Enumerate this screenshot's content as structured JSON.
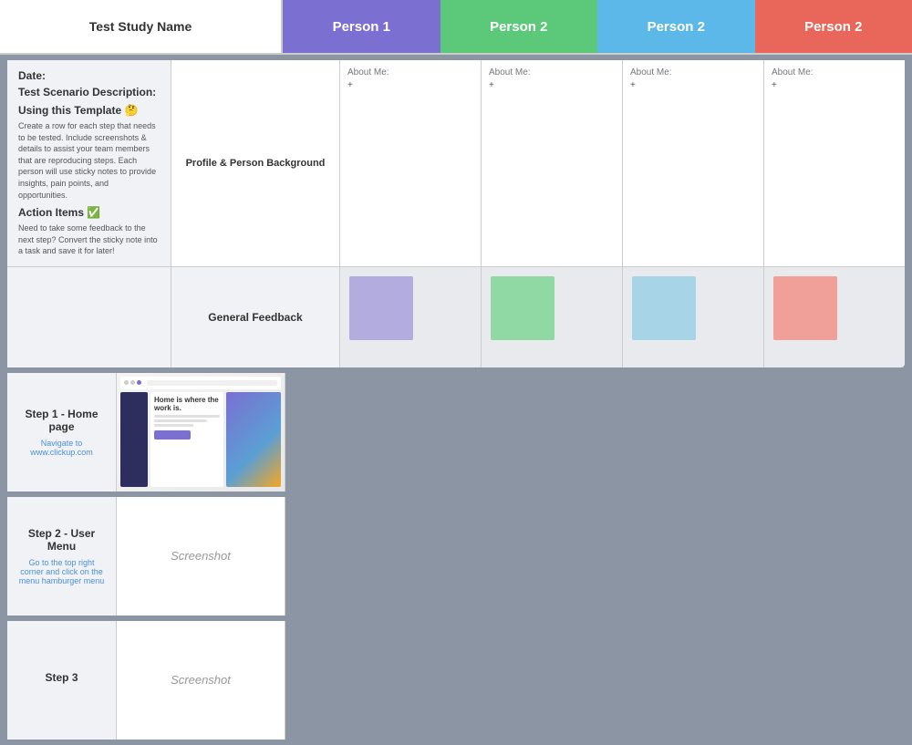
{
  "header": {
    "study_name": "Test Study Name",
    "columns": [
      {
        "label": "Person 1",
        "color_class": "person1-color"
      },
      {
        "label": "Person 2",
        "color_class": "person2-green"
      },
      {
        "label": "Person 2",
        "color_class": "person2-blue"
      },
      {
        "label": "Person 2",
        "color_class": "person2-red"
      }
    ]
  },
  "intro": {
    "profile_label": "Profile & Person Background",
    "about_label": "About Me:",
    "about_value": "+"
  },
  "general_feedback": {
    "label": "General Feedback"
  },
  "left_panel": {
    "date_label": "Date:",
    "scenario_label": "Test Scenario Description:",
    "template_heading": "Using this Template 🤔",
    "template_desc": "Create a row for each step that needs to be tested. Include screenshots & details to assist your team members that are reproducing steps. Each person will use sticky notes to provide insights, pain points, and opportunities.",
    "action_heading": "Action Items ✅",
    "action_desc": "Need to take some feedback to the next step? Convert the sticky note into a task and save it for later!"
  },
  "steps": [
    {
      "title": "Step 1 - Home page",
      "subtitle": "Navigate to www.clickup.com",
      "has_real_screenshot": true,
      "screenshot_label": ""
    },
    {
      "title": "Step 2 - User Menu",
      "subtitle": "Go to the top right corner and click on the menu hamburger menu",
      "has_real_screenshot": false,
      "screenshot_label": "Screenshot"
    },
    {
      "title": "Step 3",
      "subtitle": "",
      "has_real_screenshot": false,
      "screenshot_label": "Screenshot"
    }
  ]
}
